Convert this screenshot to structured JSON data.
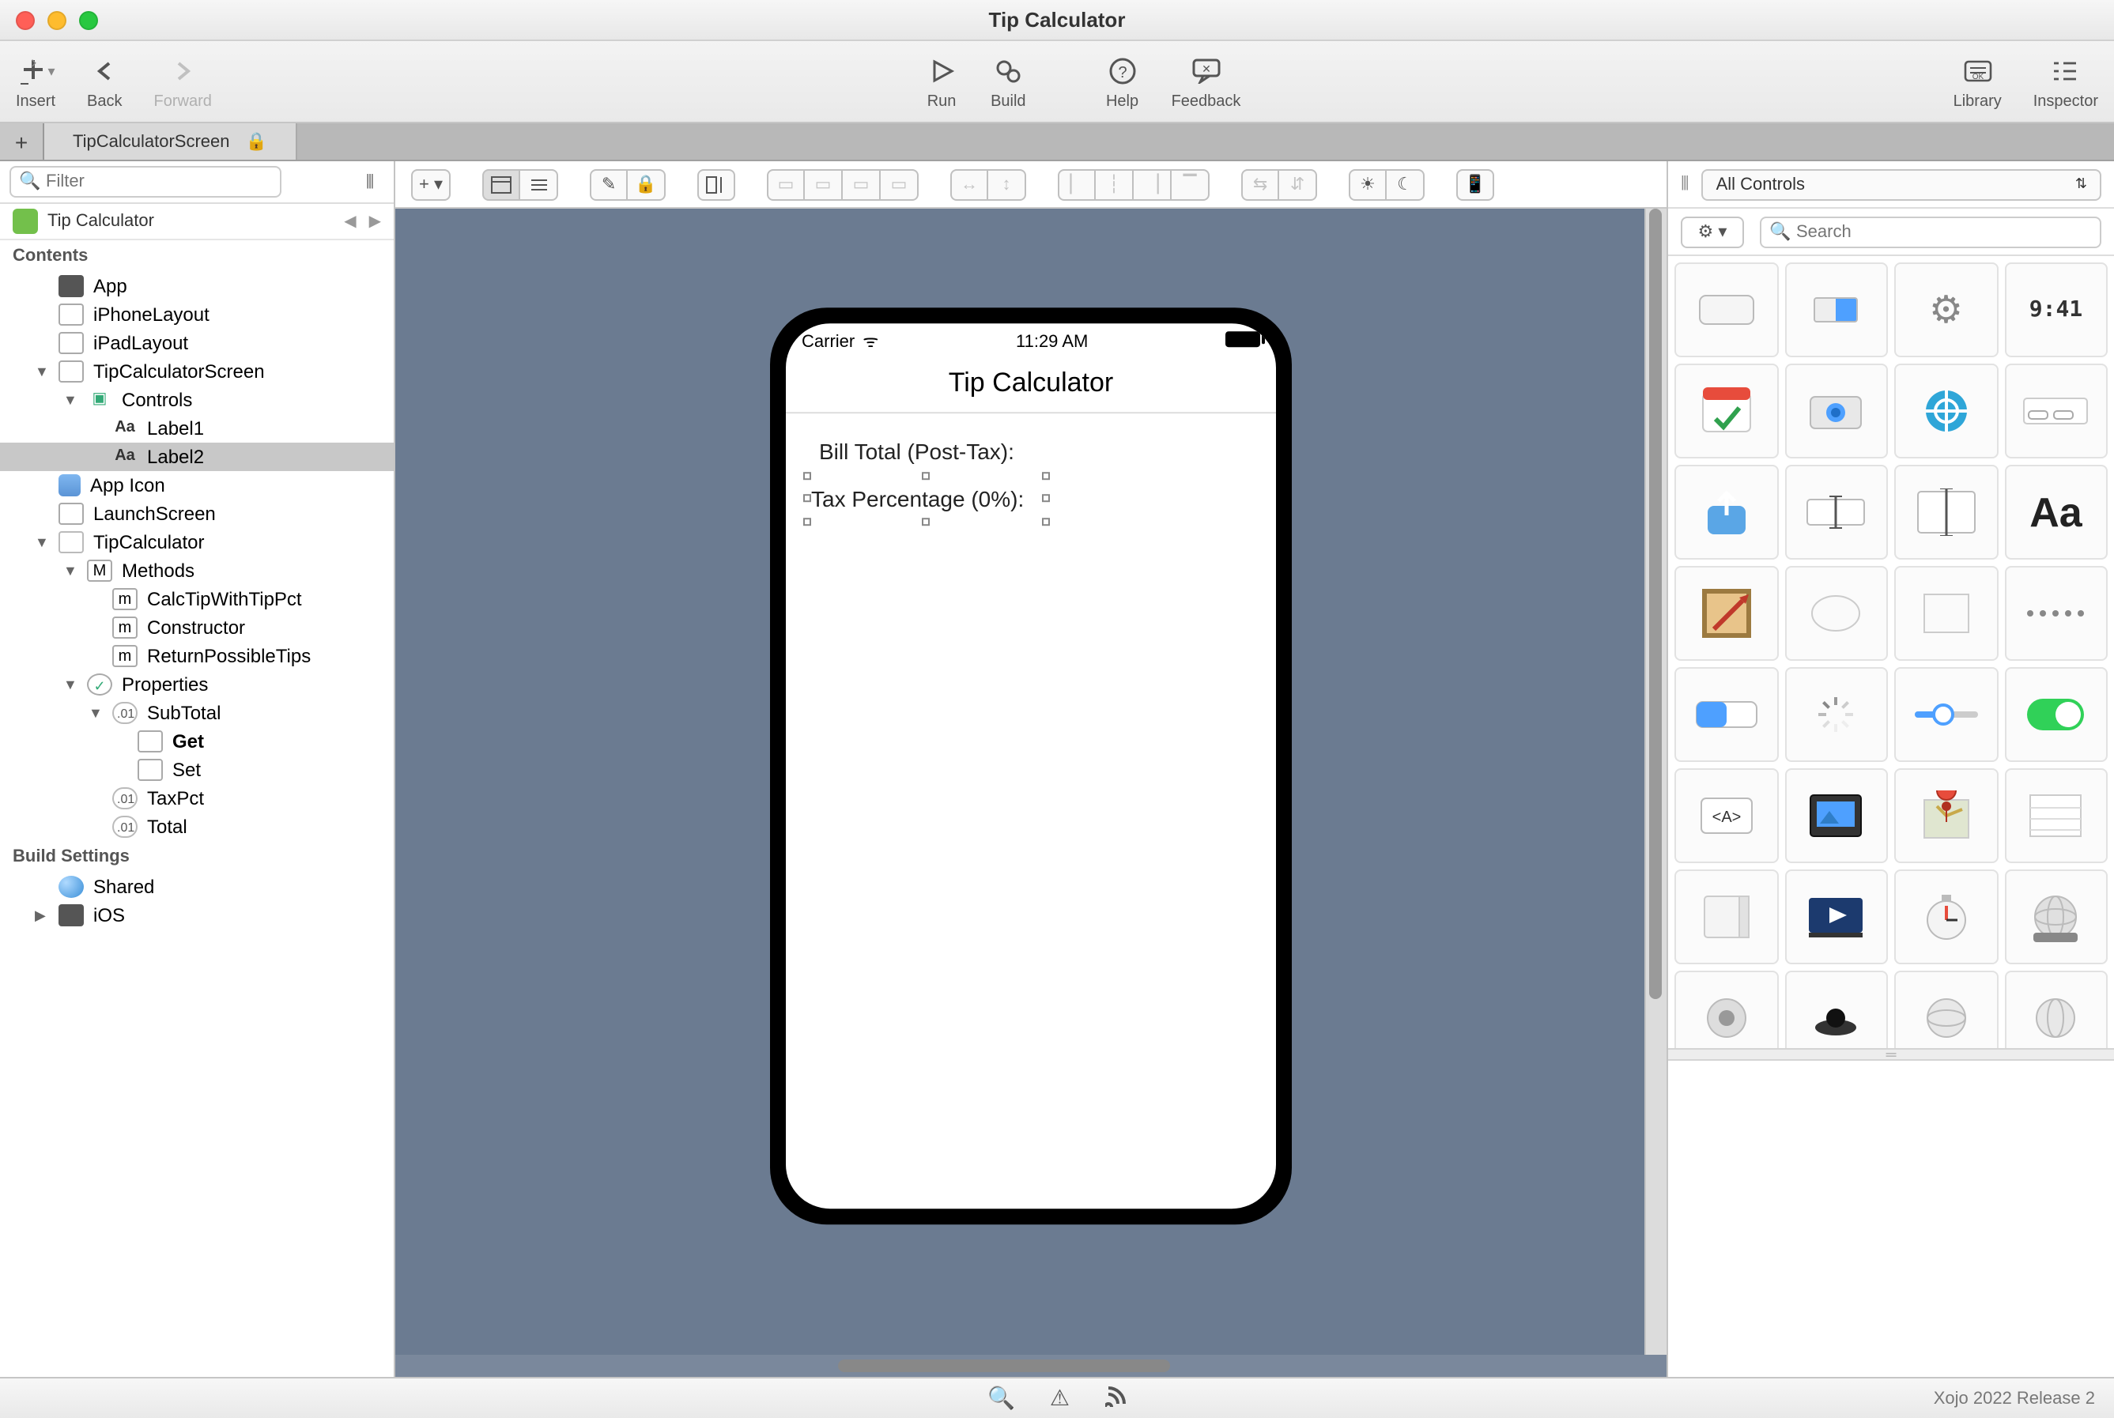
{
  "window": {
    "title": "Tip Calculator"
  },
  "toolbar": {
    "insert": "Insert",
    "back": "Back",
    "forward": "Forward",
    "run": "Run",
    "build": "Build",
    "help": "Help",
    "feedback": "Feedback",
    "library": "Library",
    "inspector": "Inspector"
  },
  "tabs": {
    "open": "TipCalculatorScreen"
  },
  "nav": {
    "filter_placeholder": "Filter",
    "project": "Tip Calculator",
    "sect_contents": "Contents",
    "app": "App",
    "iphone": "iPhoneLayout",
    "ipad": "iPadLayout",
    "screen": "TipCalculatorScreen",
    "controls": "Controls",
    "label1": "Label1",
    "label2": "Label2",
    "appicon": "App Icon",
    "launch": "LaunchScreen",
    "class": "TipCalculator",
    "methods": "Methods",
    "m1": "CalcTipWithTipPct",
    "m2": "Constructor",
    "m3": "ReturnPossibleTips",
    "properties": "Properties",
    "p1": "SubTotal",
    "p1_get": "Get",
    "p1_set": "Set",
    "p2": "TaxPct",
    "p3": "Total",
    "sect_build": "Build Settings",
    "shared": "Shared",
    "ios": "iOS"
  },
  "library": {
    "filter": "All Controls",
    "search_placeholder": "Search"
  },
  "device": {
    "carrier": "Carrier",
    "time": "11:29 AM",
    "title": "Tip Calculator",
    "label1": "Bill Total (Post-Tax):",
    "label2": "Tax Percentage (0%):"
  },
  "status": {
    "version": "Xojo 2022 Release 2"
  }
}
